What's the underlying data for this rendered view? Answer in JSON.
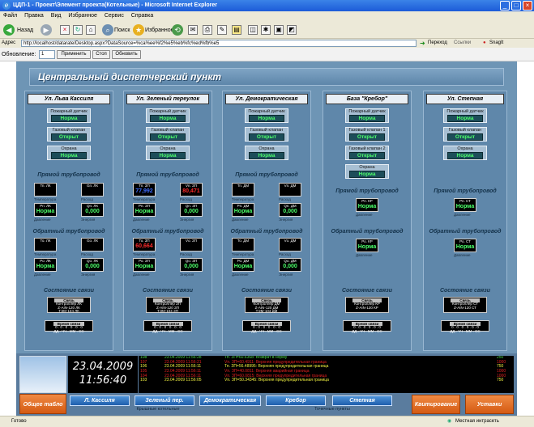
{
  "window": {
    "title": "ЦДП-1 - Проект\\Элемент проекта(Котельные) - Microsoft Internet Explorer"
  },
  "menu": [
    "Файл",
    "Правка",
    "Вид",
    "Избранное",
    "Сервис",
    "Справка"
  ],
  "toolbar": {
    "back": "Назад",
    "search": "Поиск",
    "favorites": "Избранное"
  },
  "address": {
    "label": "Адрес",
    "url": "http://localhost/datarate/Desktop.aspx?DataSource=%ca%ee%f2%e5%eb%fc%ed%fb%e5",
    "go": "Переход",
    "links": "Ссылки",
    "snagit": "SnagIt"
  },
  "refresh": {
    "label": "Обновление:",
    "value": "1",
    "apply": "Применить",
    "stop": "Стоп",
    "update": "Обновить"
  },
  "scada": {
    "title": "Центральный диспетчерский пункт",
    "columns": [
      {
        "name": "Ул. Льва Кассиля",
        "signals": [
          {
            "label": "Пожарный датчик",
            "value": "Норма"
          },
          {
            "label": "Газовый клапан",
            "value": "Открыт"
          },
          {
            "label": "Охрана",
            "value": "Норма"
          }
        ],
        "meters": {
          "t1": {
            "t": "Тп. ЛК",
            "v": "",
            "c": "Температура"
          },
          "g1": {
            "t": "Gп. ЛК",
            "v": "",
            "c": "Расход"
          },
          "p1": {
            "t": "Рп. ЛК",
            "v": "Норма",
            "c": "Давление"
          },
          "q1": {
            "t": "Qп. ЛК",
            "v": "0,000",
            "c": "Энергия"
          },
          "t2": {
            "t": "То. ЛК",
            "v": "",
            "c": "Температура"
          },
          "g2": {
            "t": "Gо. ЛК",
            "v": "",
            "c": "Расход"
          },
          "p2": {
            "t": "Ро. ЛК",
            "v": "Норма",
            "c": "Давление"
          },
          "q2": {
            "t": "Qо. ЛК",
            "v": "0,000",
            "c": "Энергия"
          }
        },
        "conn": [
          "Связь",
          "Контроллер ЛК",
          "Z-AIN-120 ЛК",
          "ТЭМ-104 ЛК"
        ]
      },
      {
        "name": "Ул. Зеленый переулок",
        "signals": [
          {
            "label": "Пожарный датчик",
            "value": "Норма"
          },
          {
            "label": "Газовый клапан",
            "value": "Открыт"
          },
          {
            "label": "Охрана",
            "value": "Норма"
          }
        ],
        "meters": {
          "t1": {
            "t": "Тп. ЗП",
            "v": "77,992",
            "c": "Температура"
          },
          "g1": {
            "t": "Vп. ЗП",
            "v": "80,471",
            "c": "Расход"
          },
          "p1": {
            "t": "Рп. ЗП",
            "v": "Норма",
            "c": "Давление"
          },
          "q1": {
            "t": "Qп. ЗП",
            "v": "0,000",
            "c": "Энергия"
          },
          "t2": {
            "t": "То. ЗП",
            "v": "60,664",
            "c": "Температура"
          },
          "g2": {
            "t": "Vо. ЗП",
            "v": "",
            "c": "Расход"
          },
          "p2": {
            "t": "Ро. ЗП",
            "v": "Норма",
            "c": "Давление"
          },
          "q2": {
            "t": "Qо. ЗП",
            "v": "0,000",
            "c": "Энергия"
          }
        },
        "conn": [
          "Связь",
          "Контроллер ЗП",
          "Z-AIN-120 ЗП",
          "ТЭМ-104 ЗП"
        ]
      },
      {
        "name": "Ул. Демократическая",
        "signals": [
          {
            "label": "Пожарный датчик",
            "value": "Норма"
          },
          {
            "label": "Газовый клапан",
            "value": "Открыт"
          },
          {
            "label": "Охрана",
            "value": "Норма"
          }
        ],
        "meters": {
          "t1": {
            "t": "Тп. ДМ",
            "v": "",
            "c": "Температура"
          },
          "g1": {
            "t": "Vп. ДМ",
            "v": "",
            "c": "Расход"
          },
          "p1": {
            "t": "Рп. ДМ",
            "v": "Норма",
            "c": "Давление"
          },
          "q1": {
            "t": "Qп. ДМ",
            "v": "0,000",
            "c": "Энергия"
          },
          "t2": {
            "t": "То. ДМ",
            "v": "",
            "c": "Температура"
          },
          "g2": {
            "t": "Vо. ДМ",
            "v": "",
            "c": "Расход"
          },
          "p2": {
            "t": "Ро. ДМ",
            "v": "Норма",
            "c": "Давление"
          },
          "q2": {
            "t": "Qо. ДМ",
            "v": "0,000",
            "c": "Энергия"
          }
        },
        "conn": [
          "Связь",
          "Контроллер ДМ",
          "Z-AIN-120 ДМ",
          "ТЭМ-104 ДМ"
        ]
      },
      {
        "name": "База \"Кребор\"",
        "signals": [
          {
            "label": "Пожарный датчик",
            "value": "Норма"
          },
          {
            "label": "Газовый клапан 1",
            "value": "Открыт"
          },
          {
            "label": "Газовый клапан 2",
            "value": "Открыт"
          },
          {
            "label": "Охрана",
            "value": "Норма"
          }
        ],
        "meters": {
          "p1": {
            "t": "Рп. КР",
            "v": "Норма",
            "c": "Давление"
          },
          "p2": {
            "t": "Ро. КР",
            "v": "Норма",
            "c": "Давление"
          }
        },
        "conn": [
          "Связь",
          "Контроллер КР",
          "Z-AIN-120 КР"
        ]
      },
      {
        "name": "Ул. Степная",
        "signals": [
          {
            "label": "Пожарный датчик",
            "value": "Норма"
          },
          {
            "label": "Газовый клапан",
            "value": "Открыт"
          },
          {
            "label": "Охрана",
            "value": "Норма"
          }
        ],
        "meters": {
          "p1": {
            "t": "Рп. СТ",
            "v": "Норма",
            "c": "Давление"
          },
          "p2": {
            "t": "Ро. СТ",
            "v": "Норма",
            "c": "Давление"
          }
        },
        "conn": [
          "Связь",
          "Контроллер СТ",
          "Z-AIN-120 СТ"
        ]
      }
    ],
    "section_direct": "Прямой трубопровод",
    "section_return": "Обратный трубопровод",
    "section_conn": "Состояние связи",
    "time_title": "Время связи",
    "time_digits": "0 . 0 . 0 . 0 . 0 . 0",
    "time_units": "ДД . ЧЧ . ММ . СС"
  },
  "clock": {
    "date": "23.04.2009",
    "time": "11:56:40"
  },
  "events": [
    {
      "id": "108",
      "ts": "23.04.2009 11:56:28",
      "msg": "Тп. ЗП=60.6368: Возврат в норму",
      "val": "250",
      "color": "#4cd84c"
    },
    {
      "id": "107",
      "ts": "23.04.2009 11:56:21",
      "msg": "Vп. ЗП=60.4911: Верхняя предупредительная граница",
      "val": "1000",
      "color": "#e02020"
    },
    {
      "id": "106",
      "ts": "23.04.2009 11:56:11",
      "msg": "Тп. ЗП=56.48995: Верхняя предупредительная граница",
      "val": "750",
      "color": "#f0f040"
    },
    {
      "id": "105",
      "ts": "23.04.2009 11:56:11",
      "msg": "Vп. ЗП=40.0811: Верхняя аварийная граница",
      "val": "1000",
      "color": "#e02020"
    },
    {
      "id": "104",
      "ts": "23.04.2009 11:56:11",
      "msg": "Vп. ЗП=60.0815: Верхняя предупредительная граница",
      "val": "1000",
      "color": "#e02020"
    },
    {
      "id": "103",
      "ts": "23.04.2009 11:56:05",
      "msg": "Vп. ЗП=50.34345: Верхняя предупредительная граница",
      "val": "750",
      "color": "#f0f040"
    }
  ],
  "nav": {
    "general": "Общее табло",
    "kassil": "Л. Кассиля",
    "zelen": "Зеленый пер.",
    "demokr": "Демократическая",
    "kribor": "Кребор",
    "stepn": "Степная",
    "group1": "Крышные котельные",
    "group2": "Точечные пункты",
    "ack": "Квитирование",
    "settings": "Уставки"
  },
  "status": {
    "left": "Готово",
    "right": "Местная интрасеть"
  },
  "colors": {
    "ok_green": "#4cff6a",
    "alarm_red": "#ff2a2a",
    "temp_blue": "#3e6cff",
    "orange": "#e66b22"
  }
}
